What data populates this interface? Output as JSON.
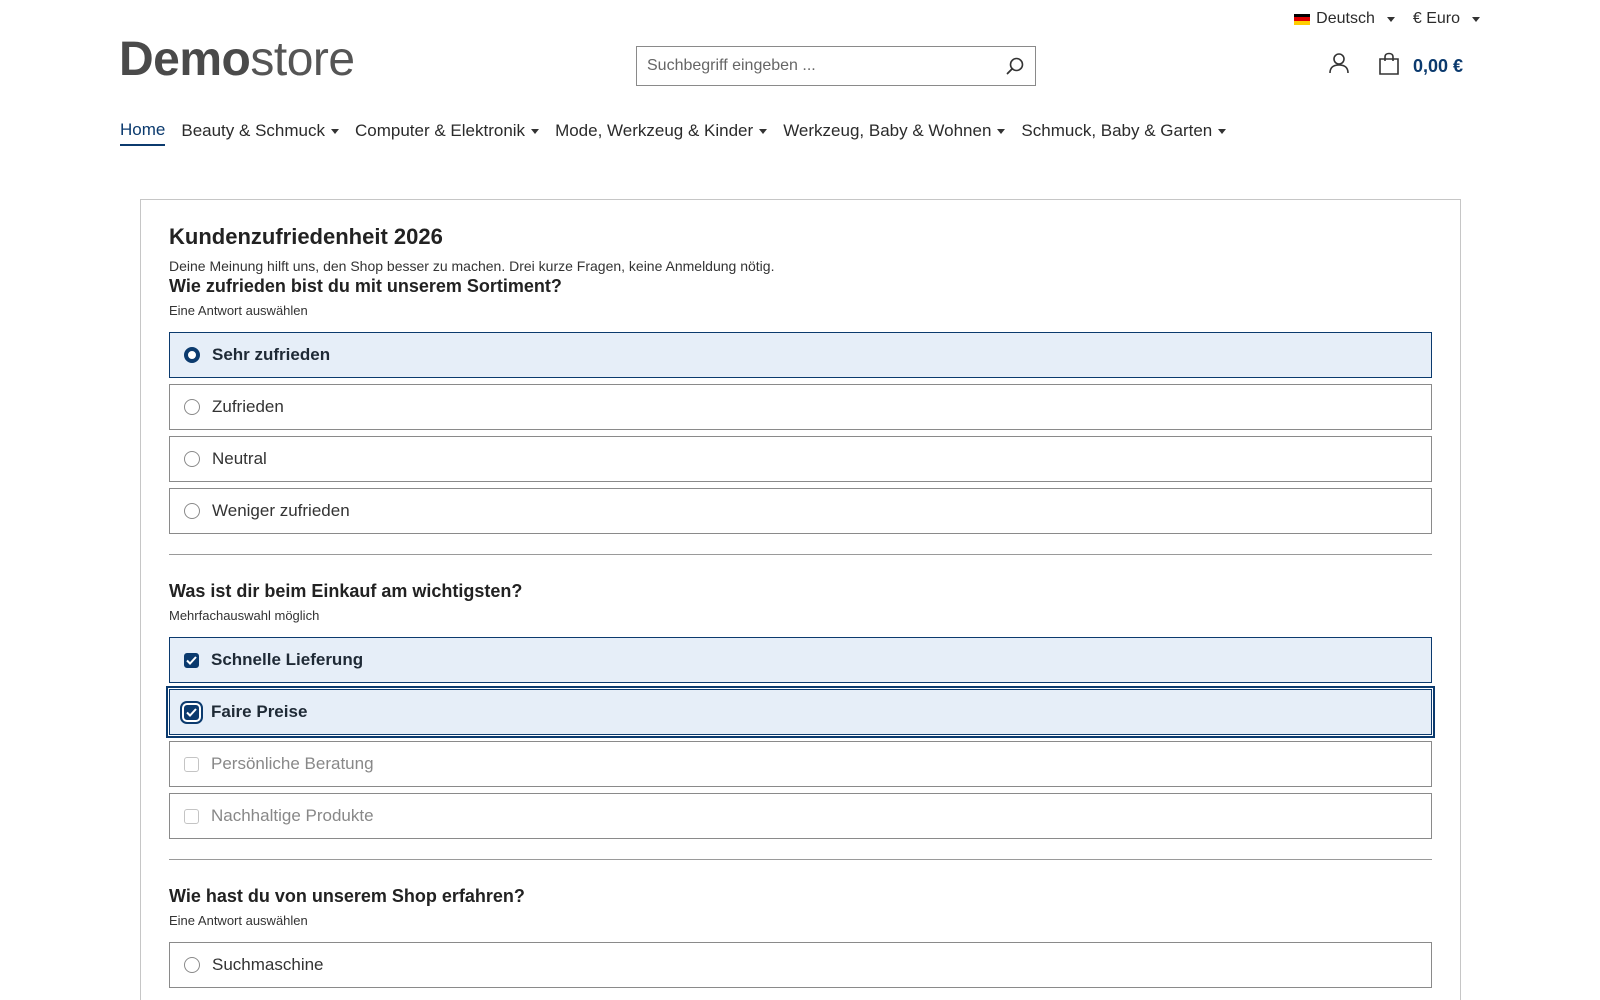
{
  "topbar": {
    "language": "Deutsch",
    "currency": "€ Euro"
  },
  "header": {
    "logo_bold": "Demo",
    "logo_light": "store",
    "search_placeholder": "Suchbegriff eingeben ...",
    "cart_total": "0,00 €"
  },
  "nav": {
    "items": [
      {
        "label": "Home",
        "active": true
      },
      {
        "label": "Beauty & Schmuck"
      },
      {
        "label": "Computer & Elektronik"
      },
      {
        "label": "Mode, Werkzeug & Kinder"
      },
      {
        "label": "Werkzeug, Baby & Wohnen"
      },
      {
        "label": "Schmuck, Baby & Garten"
      }
    ]
  },
  "survey": {
    "title": "Kundenzufriedenheit 2026",
    "intro": "Deine Meinung hilft uns, den Shop besser zu machen. Drei kurze Fragen, keine Anmeldung nötig.",
    "questions": [
      {
        "title": "Wie zufrieden bist du mit unserem Sortiment?",
        "hint": "Eine Antwort auswählen",
        "options": [
          "Sehr zufrieden",
          "Zufrieden",
          "Neutral",
          "Weniger zufrieden"
        ]
      },
      {
        "title": "Was ist dir beim Einkauf am wichtigsten?",
        "hint": "Mehrfachauswahl möglich",
        "options": [
          "Schnelle Lieferung",
          "Faire Preise",
          "Persönliche Beratung",
          "Nachhaltige Produkte"
        ]
      },
      {
        "title": "Wie hast du von unserem Shop erfahren?",
        "hint": "Eine Antwort auswählen",
        "options": [
          "Suchmaschine"
        ]
      }
    ]
  },
  "colors": {
    "accent": "#0b3a6e",
    "selected_bg": "#e6eef8"
  }
}
